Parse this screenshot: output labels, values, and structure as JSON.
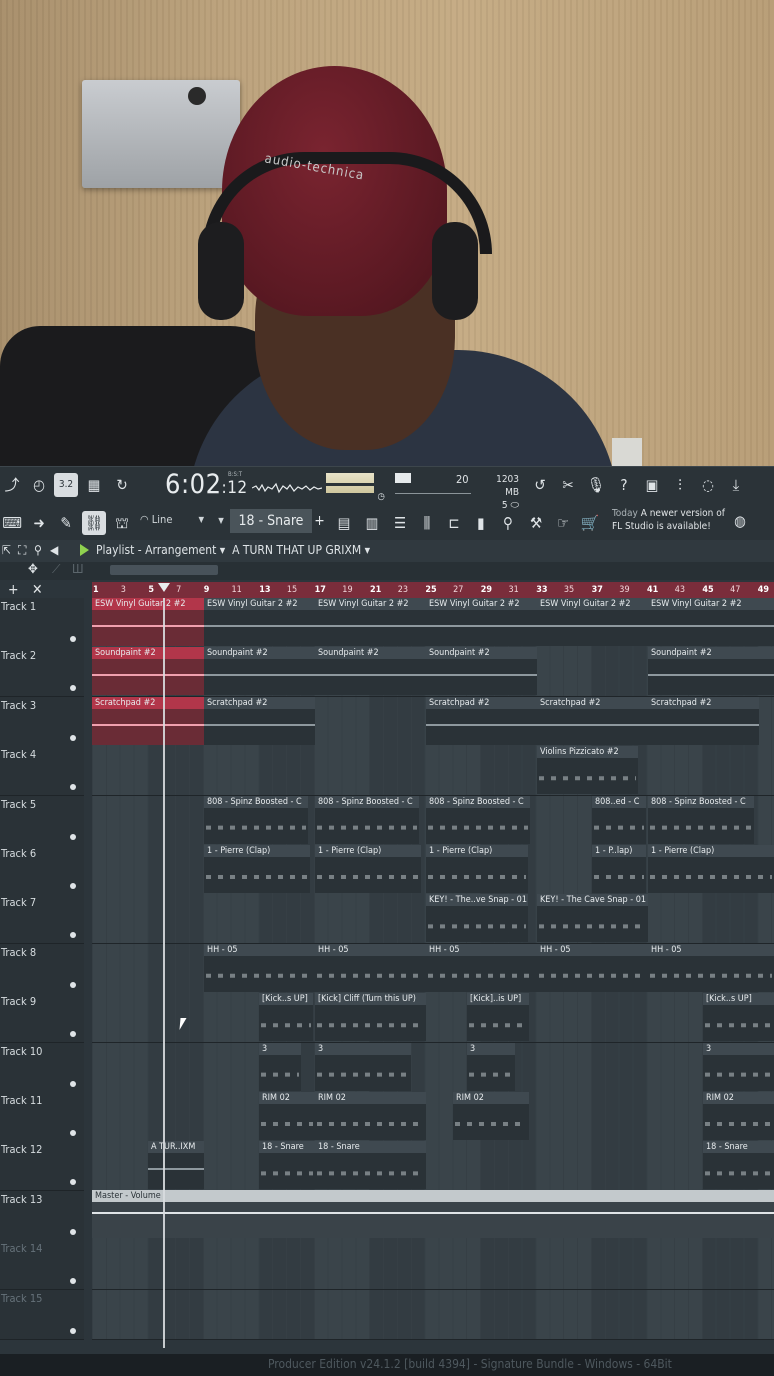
{
  "webcam": {
    "headphone_brand": "audio-technica"
  },
  "toolbar": {
    "time_main": "6:02",
    "time_sub": "12",
    "time_format": "B:S:T",
    "cpu": "20",
    "memory_mb": "1203 MB",
    "polyphony": "5",
    "snap": "Line",
    "pattern": "18 - Snare",
    "news_day": "Today",
    "news_text": "A newer version of FL Studio is available!",
    "tempo_mode": "3.2"
  },
  "playlist": {
    "title": "Playlist - Arrangement",
    "arrangement": "A TURN THAT UP GRIXM",
    "bars": [
      "1",
      "3",
      "5",
      "7",
      "9",
      "11",
      "13",
      "15",
      "17",
      "19",
      "21",
      "23",
      "25",
      "27",
      "29",
      "31",
      "33",
      "35",
      "37",
      "39",
      "41",
      "43",
      "45",
      "47",
      "49"
    ]
  },
  "tracks": [
    {
      "label": "Track 1"
    },
    {
      "label": "Track 2"
    },
    {
      "label": "Track 3"
    },
    {
      "label": "Track 4"
    },
    {
      "label": "Track 5"
    },
    {
      "label": "Track 6"
    },
    {
      "label": "Track 7"
    },
    {
      "label": "Track 8"
    },
    {
      "label": "Track 9"
    },
    {
      "label": "Track 10"
    },
    {
      "label": "Track 11"
    },
    {
      "label": "Track 12"
    },
    {
      "label": "Track 13"
    },
    {
      "label": "Track 14"
    },
    {
      "label": "Track 15"
    }
  ],
  "clips": {
    "c1a": "ESW Vinyl Guitar 2 #2",
    "c1b": "ESW Vinyl Guitar 2 #2",
    "c1c": "ESW Vinyl Guitar 2 #2",
    "c1d": "ESW Vinyl Guitar 2 #2",
    "c1e": "ESW Vinyl Guitar 2 #2",
    "c1f": "ESW Vinyl Guitar 2 #2",
    "c2a": "Soundpaint #2",
    "c2b": "Soundpaint #2",
    "c2c": "Soundpaint #2",
    "c2d": "Soundpaint #2",
    "c2e": "Soundpaint #2",
    "c3a": "Scratchpad #2",
    "c3b": "Scratchpad #2",
    "c3c": "Scratchpad #2",
    "c3d": "Scratchpad #2",
    "c3e": "Scratchpad #2",
    "c4a": "Violins Pizzicato #2",
    "c5a": "808 - Spinz Boosted - C",
    "c5b": "808 - Spinz Boosted - C",
    "c5c": "808 - Spinz Boosted - C",
    "c5d": "808..ed - C",
    "c5e": "808 - Spinz Boosted - C",
    "c6a": "1 - Pierre (Clap)",
    "c6b": "1 - Pierre (Clap)",
    "c6c": "1 - Pierre (Clap)",
    "c6d": "1 - P..lap)",
    "c6e": "1 - Pierre (Clap)",
    "c7a": "KEY! - The..ve Snap - 01",
    "c7b": "KEY! - The Cave Snap - 01",
    "c8a": "HH - 05",
    "c8b": "HH - 05",
    "c8c": "HH - 05",
    "c8d": "HH - 05",
    "c8e": "HH - 05",
    "c9a": "[Kick..s UP]",
    "c9b": "[Kick] Cliff (Turn this UP)",
    "c9c": "[Kick]..is UP]",
    "c9d": "[Kick..s UP]",
    "c10a": "3",
    "c10b": "3",
    "c10c": "3",
    "c10d": "3",
    "c11a": "RIM 02",
    "c11b": "RIM 02",
    "c11c": "RIM 02",
    "c11d": "RIM 02",
    "c12a": "A TUR..IXM",
    "c12b": "18 - Snare",
    "c12c": "18 - Snare",
    "c12d": "18 - Snare",
    "master": "Master - Volume"
  },
  "footer": "Producer Edition v24.1.2 [build 4394] - Signature Bundle - Windows - 64Bit",
  "colors": {
    "accent_red": "#b2364a",
    "ruler": "#7a2d3b",
    "bg": "#2c353b"
  }
}
